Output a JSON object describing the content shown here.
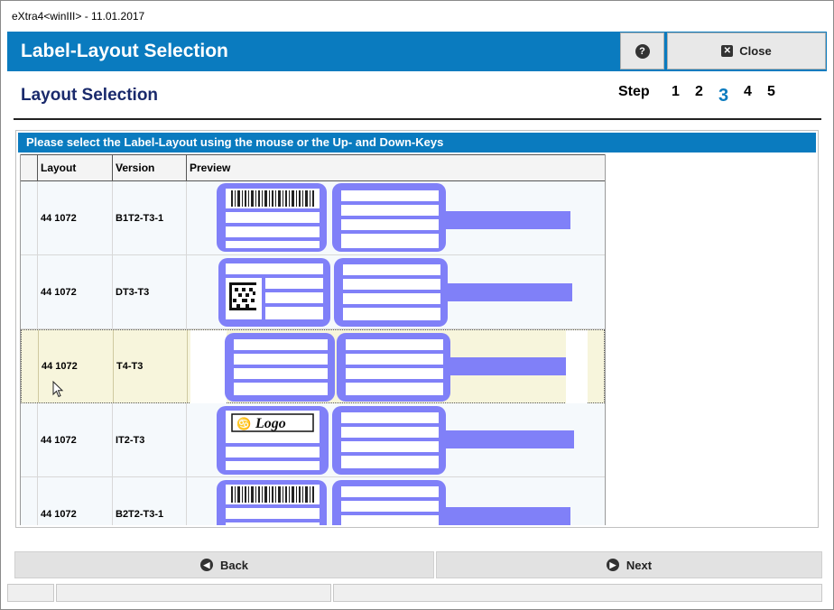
{
  "window": {
    "title": "eXtra4<winIII>  -  11.01.2017"
  },
  "header": {
    "title": "Label-Layout Selection",
    "help_icon": "question-circle-icon",
    "close_label": "Close"
  },
  "page": {
    "subtitle": "Layout Selection",
    "step_label": "Step",
    "steps": [
      "1",
      "2",
      "3",
      "4",
      "5"
    ],
    "active_step": "3"
  },
  "panel": {
    "instruction": "Please select the Label-Layout using the mouse or the Up- and Down-Keys"
  },
  "table": {
    "columns": [
      "Layout",
      "Version",
      "Preview"
    ],
    "rows": [
      {
        "layout": "44 1072",
        "version": "B1T2-T3-1",
        "preview": "barcode-label-icon"
      },
      {
        "layout": "44 1072",
        "version": "DT3-T3",
        "preview": "datamatrix-label-icon"
      },
      {
        "layout": "44 1072",
        "version": "T4-T3",
        "preview": "text-label-icon",
        "selected": true
      },
      {
        "layout": "44 1072",
        "version": "IT2-T3",
        "preview": "logo-label-icon",
        "logo_text": "Logo"
      },
      {
        "layout": "44 1072",
        "version": "B2T2-T3-1",
        "preview": "barcode-label-icon"
      }
    ]
  },
  "footer": {
    "back_label": "Back",
    "next_label": "Next"
  },
  "colors": {
    "accent": "#0a7bbf",
    "label_fill": "#8080f8",
    "selected_row": "#f7f5dc"
  }
}
